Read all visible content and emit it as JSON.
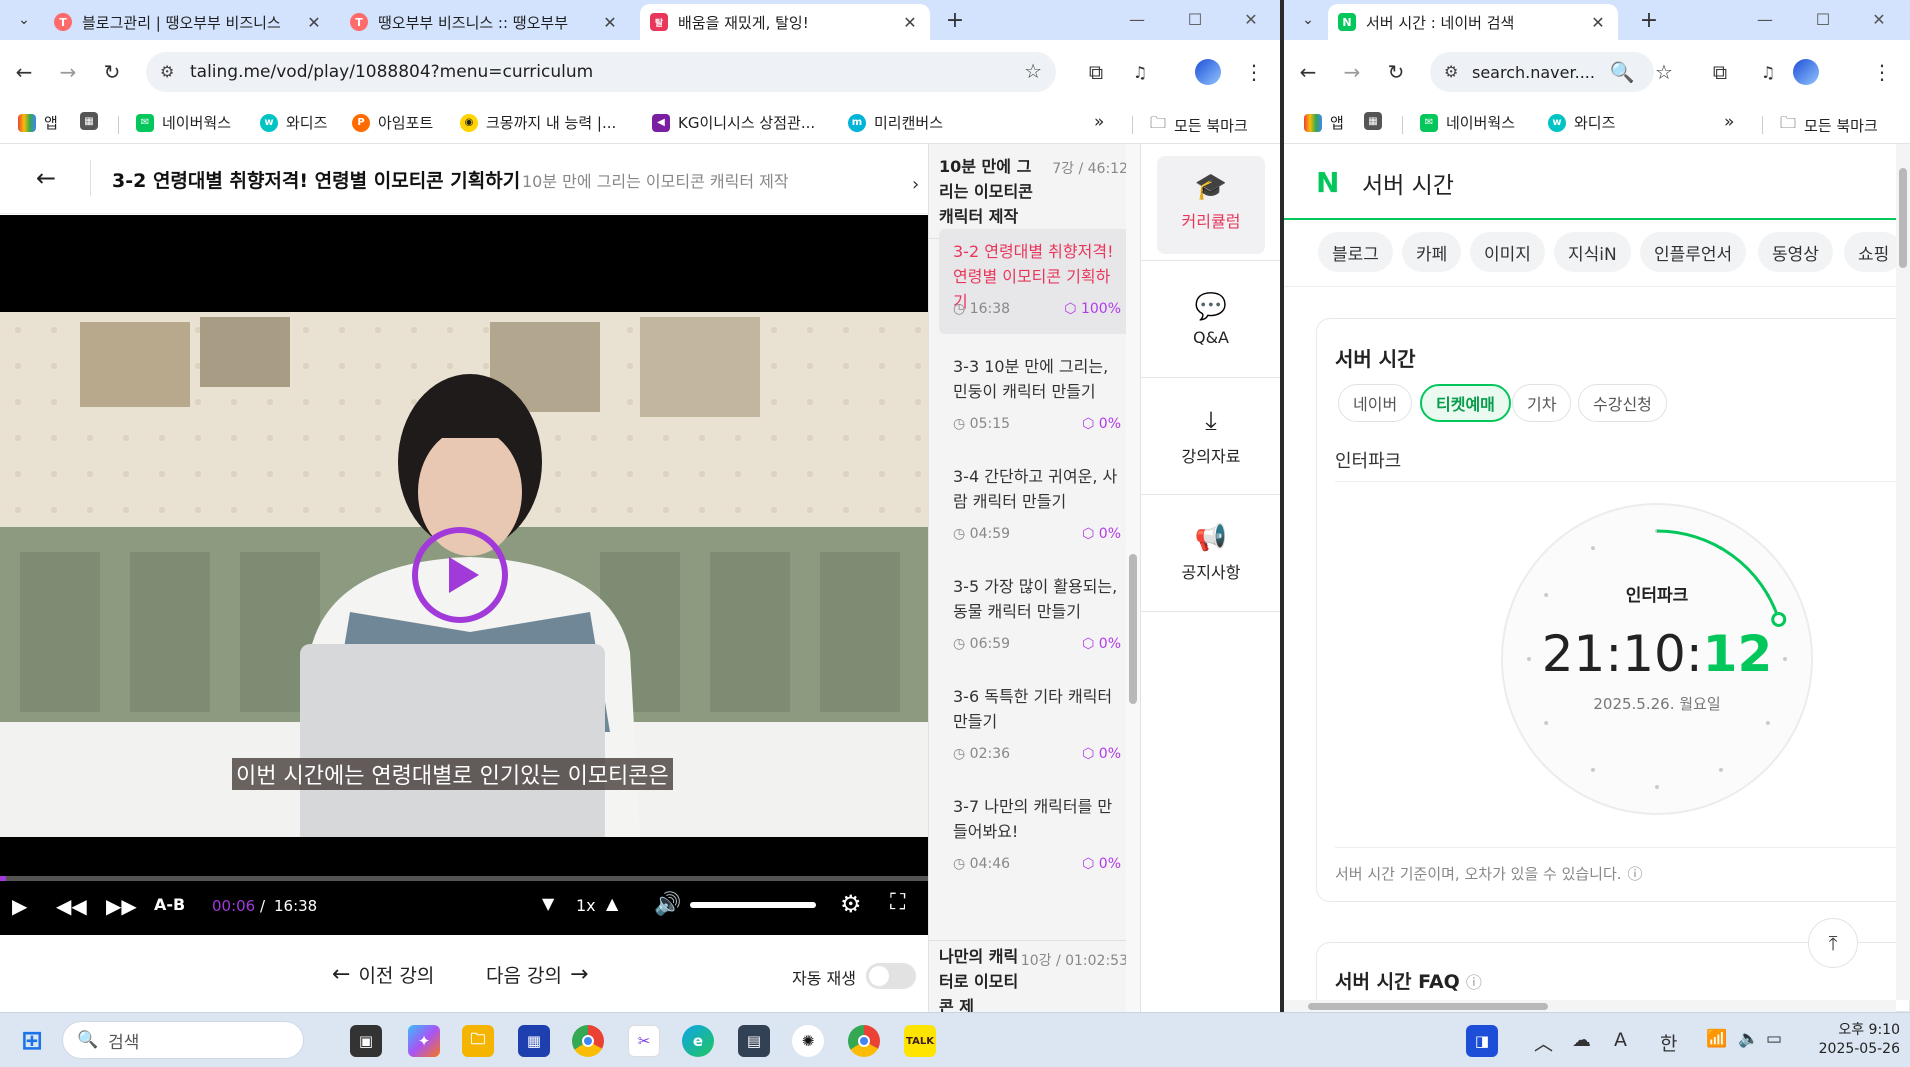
{
  "left_window": {
    "tabs": [
      {
        "title": "블로그관리 | 땡오부부 비즈니스",
        "favicon_color": "#ff6b6b"
      },
      {
        "title": "땡오부부 비즈니스 :: 땡오부부",
        "favicon_color": "#ff6b6b"
      },
      {
        "title": "배움을 재밌게, 탈잉!",
        "favicon_color": "#e8375b",
        "active": true
      }
    ],
    "url": "taling.me/vod/play/1088804?menu=curriculum",
    "bookmarks": [
      {
        "label": "앱"
      },
      {
        "label": "네이버웍스"
      },
      {
        "label": "와디즈"
      },
      {
        "label": "아임포트"
      },
      {
        "label": "크몽까지 내 능력 |..."
      },
      {
        "label": "KG이니시스 상점관..."
      },
      {
        "label": "미리캔버스"
      }
    ],
    "all_bookmarks": "모든 북마크",
    "page": {
      "title": "3-2 연령대별 취향저격! 연령별 이모티콘 기획하기",
      "subtitle": "10분 만에 그리는 이모티콘 캐릭터 제작",
      "caption": "이번 시간에는 연령대별로 인기있는 이모티콘은",
      "player": {
        "ab": "A-B",
        "current": "00:06",
        "slash": "/",
        "duration": "16:38",
        "speed": "1x",
        "progress": 0.006,
        "volume": 1.0
      },
      "prev_label": "이전 강의",
      "next_label": "다음 강의",
      "autoplay_label": "자동 재생"
    },
    "curriculum": {
      "section_title": "10분 만에 그리는 이모티콘 캐릭터 제작",
      "section_meta": "7강 / 46:12",
      "lessons": [
        {
          "title": "3-2 연령대별 취향저격! 연령별 이모티콘 기획하기",
          "duration": "16:38",
          "progress": "100%",
          "active": true
        },
        {
          "title": "3-3 10분 만에 그리는, 민둥이 캐릭터 만들기",
          "duration": "05:15",
          "progress": "0%"
        },
        {
          "title": "3-4 간단하고 귀여운, 사람 캐릭터 만들기",
          "duration": "04:59",
          "progress": "0%"
        },
        {
          "title": "3-5 가장 많이 활용되는, 동물 캐릭터 만들기",
          "duration": "06:59",
          "progress": "0%"
        },
        {
          "title": "3-6 독특한 기타 캐릭터 만들기",
          "duration": "02:36",
          "progress": "0%"
        },
        {
          "title": "3-7 나만의 캐릭터를 만들어봐요!",
          "duration": "04:46",
          "progress": "0%"
        }
      ],
      "next_section_title": "나만의 캐릭터로 이모티콘 제",
      "next_section_meta": "10강 / 01:02:53"
    },
    "side_menu": [
      "커리큘럼",
      "Q&A",
      "강의자료",
      "공지사항"
    ]
  },
  "right_window": {
    "tab_title": "서버 시간 : 네이버 검색",
    "url": "search.naver....",
    "bookmarks": [
      {
        "label": "앱"
      },
      {
        "label": "네이버웍스"
      },
      {
        "label": "와디즈"
      }
    ],
    "all_bookmarks": "모든 북마크",
    "search_query": "서버 시간",
    "search_tabs": [
      "블로그",
      "카페",
      "이미지",
      "지식iN",
      "인플루언서",
      "동영상",
      "쇼핑"
    ],
    "card": {
      "title": "서버 시간",
      "filters": [
        {
          "label": "네이버"
        },
        {
          "label": "티켓예매",
          "active": true
        },
        {
          "label": "기차"
        },
        {
          "label": "수강신청"
        }
      ],
      "site": "인터파크",
      "clock_label": "인터파크",
      "time_hm": "21:10:",
      "time_s": "12",
      "seconds": 12,
      "date": "2025.5.26. 월요일",
      "notice": "서버 시간 기준이며, 오차가 있을 수 있습니다."
    },
    "faq_title": "서버 시간 FAQ"
  },
  "taskbar": {
    "search_placeholder": "검색",
    "time": "오후 9:10",
    "date": "2025-05-26",
    "ime": "한",
    "font_a": "A"
  },
  "colors": {
    "naver_green": "#03c75a",
    "taling_red": "#e8375b",
    "progress_purple": "#b23be8"
  }
}
